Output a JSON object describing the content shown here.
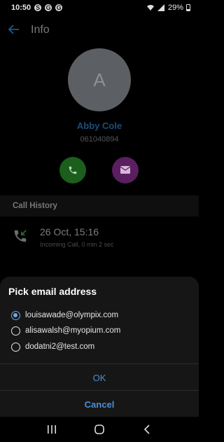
{
  "status_bar": {
    "time": "10:50",
    "notification_icons": [
      "S",
      "G",
      "G"
    ],
    "battery": "29%"
  },
  "app_bar": {
    "title": "Info"
  },
  "contact": {
    "initial": "A",
    "name": "Abby Cole",
    "number": "061040894"
  },
  "call_history": {
    "header": "Call History",
    "entries": [
      {
        "date": "26 Oct, 15:16",
        "detail": "Incoming Call, 0 min 2 sec"
      }
    ]
  },
  "email_dialog": {
    "title": "Pick email address",
    "options": [
      {
        "email": "louisawade@olympix.com",
        "selected": true
      },
      {
        "email": "alisawalsh@myopium.com",
        "selected": false
      },
      {
        "email": "dodatni2@test.com",
        "selected": false
      }
    ],
    "ok_label": "OK",
    "cancel_label": "Cancel"
  },
  "colors": {
    "accent": "#4a8fd6",
    "call_button": "#1c5e1c",
    "mail_button": "#5a1f5e"
  }
}
